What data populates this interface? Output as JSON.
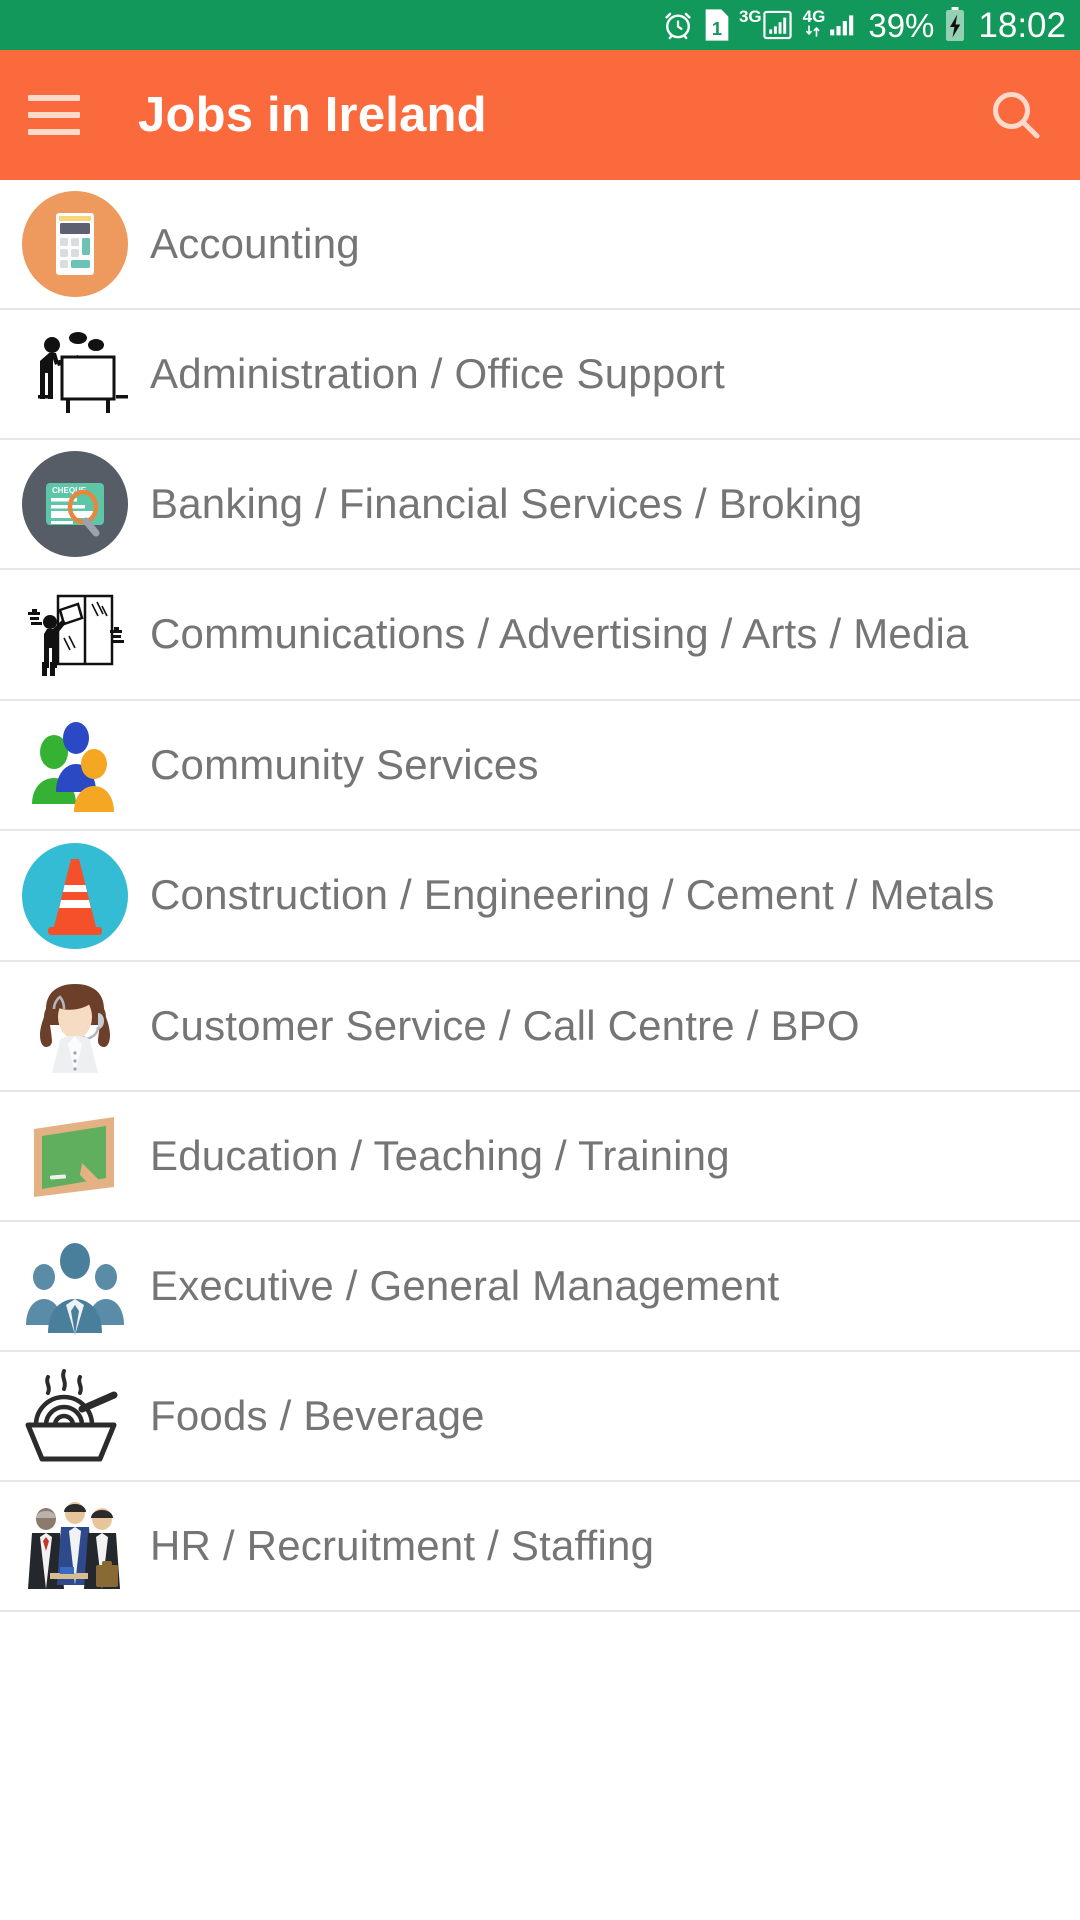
{
  "statusbar": {
    "icons": [
      "alarm-clock-icon",
      "sim-card-icon",
      "signal-3g-icon",
      "signal-4g-icon"
    ],
    "sim_label": "1",
    "network_3g_label": "3G",
    "network_4g_label": "4G",
    "battery_percent": "39%",
    "battery_state": "charging",
    "time": "18:02",
    "background_color": "#12985A"
  },
  "appbar": {
    "menu_icon": "hamburger-menu-icon",
    "title": "Jobs in Ireland",
    "search_icon": "search-icon",
    "background_color": "#FA6A3C",
    "title_color": "#FFFFFF"
  },
  "list": {
    "divider_color": "#E6E6E6",
    "label_color": "#757575",
    "items": [
      {
        "label": "Accounting",
        "icon": "calculator-icon"
      },
      {
        "label": "Administration / Office Support",
        "icon": "presenter-whiteboard-icon"
      },
      {
        "label": "Banking / Financial Services / Broking",
        "icon": "cheque-magnifier-icon"
      },
      {
        "label": "Communications / Advertising / Arts / Media",
        "icon": "person-poster-board-icon"
      },
      {
        "label": "Community Services",
        "icon": "three-people-color-icon"
      },
      {
        "label": "Construction / Engineering / Cement / Metals",
        "icon": "traffic-cone-icon"
      },
      {
        "label": "Customer Service / Call Centre / BPO",
        "icon": "headset-agent-icon"
      },
      {
        "label": "Education / Teaching / Training",
        "icon": "chalkboard-icon"
      },
      {
        "label": "Executive / General Management",
        "icon": "business-team-icon"
      },
      {
        "label": "Foods / Beverage",
        "icon": "noodle-bowl-icon"
      },
      {
        "label": "HR / Recruitment / Staffing",
        "icon": "recruiters-icon"
      }
    ]
  }
}
